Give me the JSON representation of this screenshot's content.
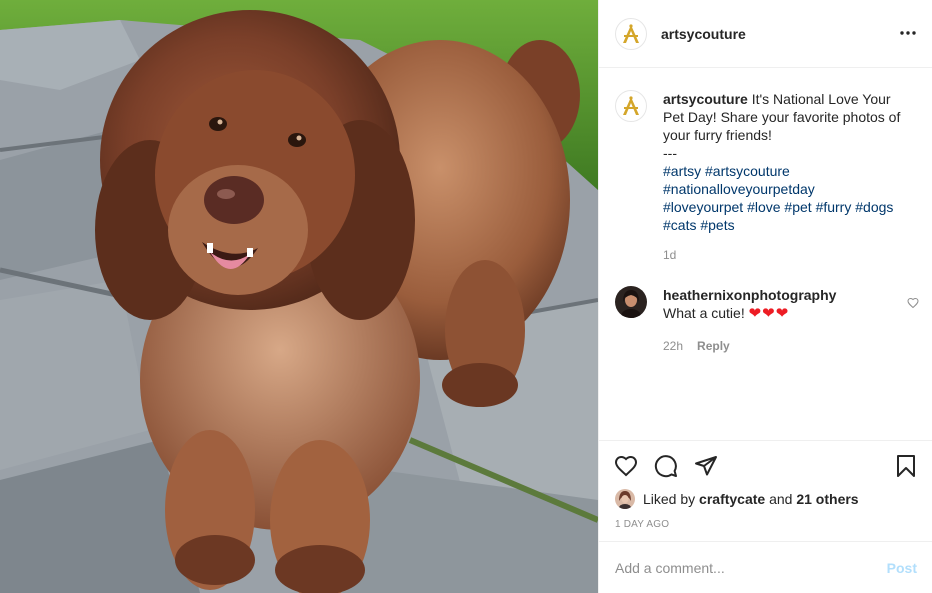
{
  "post": {
    "author": "artsycouture",
    "more_icon": "more-horizontal-icon",
    "image_alt": "Fluffy brown doodle dog",
    "caption": {
      "username": "artsycouture",
      "text": "It's National Love Your Pet Day! Share your favorite photos of your furry friends!",
      "separator": "---",
      "hashtags": [
        "#artsy",
        "#artsycouture",
        "#nationalloveyourpetday",
        "#loveyourpet",
        "#love",
        "#pet",
        "#furry",
        "#dogs",
        "#cats",
        "#pets"
      ],
      "age": "1d"
    },
    "comments": [
      {
        "username": "heathernixonphotography",
        "text": "What a cutie!",
        "hearts": "❤❤❤",
        "age": "22h",
        "reply_label": "Reply"
      }
    ],
    "actions": {
      "like_icon": "heart-icon",
      "comment_icon": "comment-icon",
      "share_icon": "share-icon",
      "save_icon": "bookmark-icon"
    },
    "likes": {
      "prefix": "Liked by",
      "user": "craftycate",
      "connector": "and",
      "others": "21 others"
    },
    "date": "1 DAY AGO",
    "add_comment": {
      "placeholder": "Add a comment...",
      "post_label": "Post"
    },
    "colors": {
      "brand_gold": "#d4a62a",
      "hashtag": "#00376b",
      "post_disabled": "#b2dffc",
      "heart_red": "#ed1c24"
    }
  }
}
